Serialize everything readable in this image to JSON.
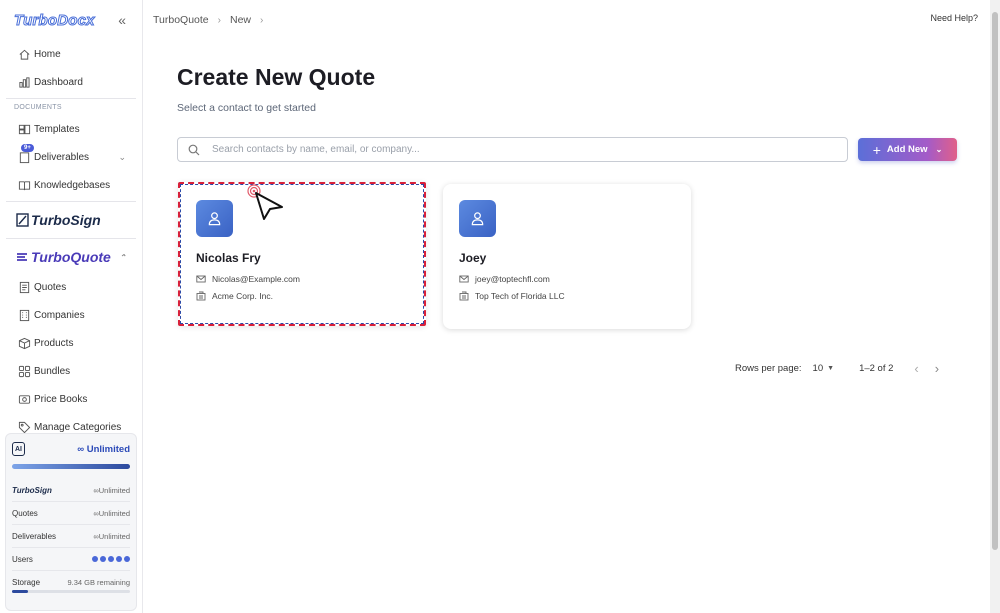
{
  "app": {
    "logo_text": "TurboDocx"
  },
  "sidebar": {
    "items_top": [
      {
        "label": "Home",
        "icon": "home-icon"
      },
      {
        "label": "Dashboard",
        "icon": "chart-icon"
      }
    ],
    "documents_label": "DOCUMENTS",
    "documents_items": [
      {
        "label": "Templates",
        "icon": "templates-icon"
      },
      {
        "label": "Deliverables",
        "icon": "deliverables-icon",
        "badge": "9+"
      },
      {
        "label": "Knowledgebases",
        "icon": "book-icon"
      }
    ],
    "turbosign_label": "TurboSign",
    "turboquote_label": "TurboQuote",
    "quote_items": [
      {
        "label": "Quotes",
        "icon": "quote-doc-icon"
      },
      {
        "label": "Companies",
        "icon": "building-icon"
      },
      {
        "label": "Products",
        "icon": "box-icon"
      },
      {
        "label": "Bundles",
        "icon": "bundle-icon"
      },
      {
        "label": "Price Books",
        "icon": "price-book-icon"
      },
      {
        "label": "Manage Categories",
        "icon": "tag-icon"
      }
    ],
    "usage": {
      "ai_label": "AI",
      "ai_value": "Unlimited",
      "rows": [
        {
          "label": "TurboSign",
          "value": "Unlimited"
        },
        {
          "label": "Quotes",
          "value": "Unlimited"
        },
        {
          "label": "Deliverables",
          "value": "Unlimited"
        },
        {
          "label": "Users",
          "value": ""
        },
        {
          "label": "Storage",
          "value": "9.34 GB remaining"
        }
      ]
    }
  },
  "breadcrumb": {
    "items": [
      "TurboQuote",
      "New"
    ]
  },
  "header": {
    "help": "Need Help?"
  },
  "main": {
    "title": "Create New Quote",
    "subtitle": "Select a contact to get started",
    "search_placeholder": "Search contacts by name, email, or company...",
    "add_button": "Add New"
  },
  "contacts": [
    {
      "name": "Nicolas Fry",
      "email": "Nicolas@Example.com",
      "company": "Acme Corp. Inc."
    },
    {
      "name": "Joey",
      "email": "joey@toptechfl.com",
      "company": "Top Tech of Florida LLC"
    }
  ],
  "pagination": {
    "rows_per_page_label": "Rows per page:",
    "rows_per_page": "10",
    "range": "1–2 of 2"
  },
  "colors": {
    "accent": "#4a68d8",
    "selection": "#d8203a"
  }
}
